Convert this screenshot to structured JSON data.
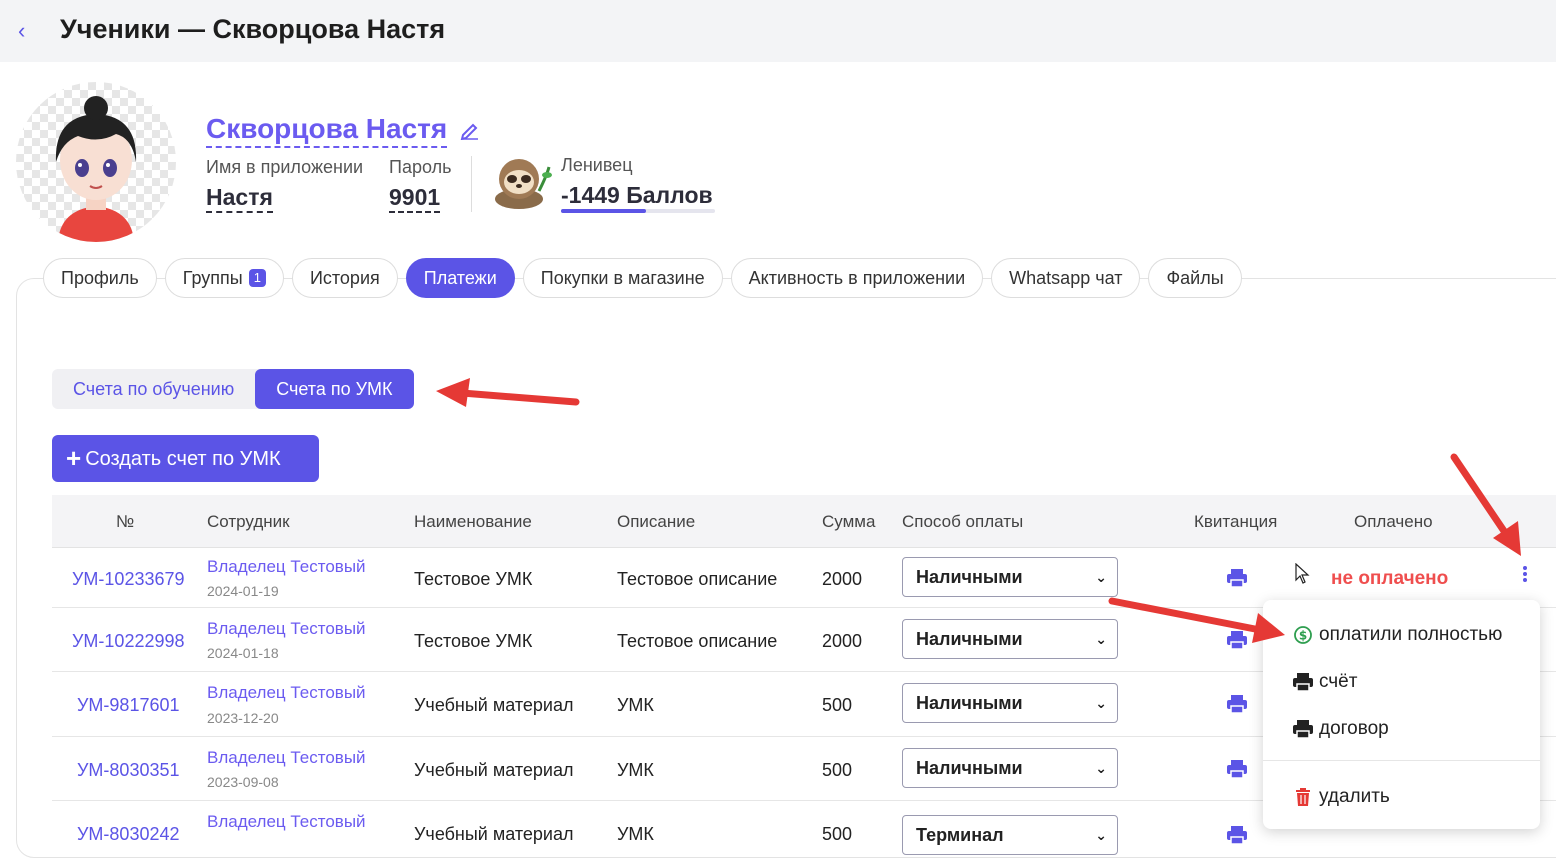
{
  "header": {
    "back_icon": "chevron-left-icon",
    "title": "Ученики — Скворцова Настя"
  },
  "profile": {
    "name": "Скворцова Настя",
    "app_name_label": "Имя в приложении",
    "app_name_value": "Настя",
    "password_label": "Пароль",
    "password_value": "9901",
    "level_label": "Ленивец",
    "points_value": "-1449 Баллов",
    "points_progress": 0.55
  },
  "tabs": [
    {
      "label": "Профиль"
    },
    {
      "label": "Группы",
      "badge": "1"
    },
    {
      "label": "История"
    },
    {
      "label": "Платежи",
      "active": true
    },
    {
      "label": "Покупки в магазине"
    },
    {
      "label": "Активность в приложении"
    },
    {
      "label": "Whatsapp чат"
    },
    {
      "label": "Файлы"
    }
  ],
  "subtabs": {
    "training": "Счета по обучению",
    "umk": "Счета по УМК",
    "active": "umk"
  },
  "create_button": {
    "label": "Создать счет по УМК"
  },
  "table": {
    "headers": {
      "num": "№",
      "employee": "Сотрудник",
      "name": "Наименование",
      "description": "Описание",
      "sum": "Сумма",
      "payment_method": "Способ оплаты",
      "receipt": "Квитанция",
      "paid": "Оплачено"
    },
    "rows": [
      {
        "num": "УМ-10233679",
        "employee": "Владелец Тестовый",
        "date": "2024-01-19",
        "name": "Тестовое УМК",
        "description": "Тестовое описание",
        "sum": "2000",
        "method": "Наличными",
        "status": "не оплачено"
      },
      {
        "num": "УМ-10222998",
        "employee": "Владелец Тестовый",
        "date": "2024-01-18",
        "name": "Тестовое УМК",
        "description": "Тестовое описание",
        "sum": "2000",
        "method": "Наличными"
      },
      {
        "num": "УМ-9817601",
        "employee": "Владелец Тестовый",
        "date": "2023-12-20",
        "name": "Учебный материал",
        "description": "УМК",
        "sum": "500",
        "method": "Наличными"
      },
      {
        "num": "УМ-8030351",
        "employee": "Владелец Тестовый",
        "date": "2023-09-08",
        "name": "Учебный материал",
        "description": "УМК",
        "sum": "500",
        "method": "Наличными"
      },
      {
        "num": "УМ-8030242",
        "employee": "Владелец Тестовый",
        "date": "",
        "name": "Учебный материал",
        "description": "УМК",
        "sum": "500",
        "method": "Терминал"
      }
    ]
  },
  "context_menu": {
    "paid_full": "оплатили полностью",
    "invoice": "счёт",
    "contract": "договор",
    "delete": "удалить"
  },
  "colors": {
    "accent": "#5b54e6",
    "unpaid": "#ef4e4e",
    "annotation_arrow": "#e53935"
  }
}
